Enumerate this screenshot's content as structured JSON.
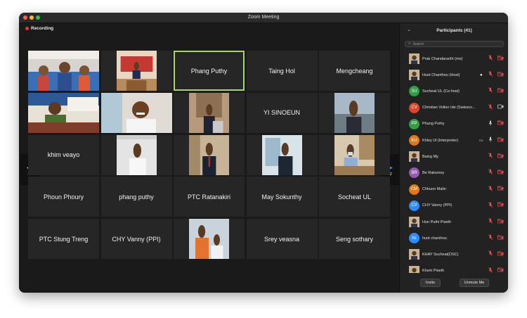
{
  "window": {
    "title": "Zoom Meeting"
  },
  "recording": {
    "label": "Recording"
  },
  "grid": {
    "page_indicator": "1/2",
    "tiles": [
      {
        "type": "video",
        "name": "",
        "scene": "group-outdoor"
      },
      {
        "type": "video",
        "name": "",
        "scene": "speaker-podium"
      },
      {
        "type": "name",
        "name": "Phang Puthy",
        "active": true
      },
      {
        "type": "name",
        "name": "Taing Hol"
      },
      {
        "type": "name",
        "name": "Mengcheang"
      },
      {
        "type": "video",
        "name": "",
        "scene": "speaker-banner"
      },
      {
        "type": "video",
        "name": "",
        "scene": "smiling-man"
      },
      {
        "type": "video",
        "name": "",
        "scene": "office-suit"
      },
      {
        "type": "name",
        "name": "YI SINOEUN"
      },
      {
        "type": "video",
        "name": "",
        "scene": "man-outdoor"
      },
      {
        "type": "name",
        "name": "khim veayo"
      },
      {
        "type": "video",
        "name": "",
        "scene": "man-white-shirt"
      },
      {
        "type": "video",
        "name": "",
        "scene": "man-suit-room"
      },
      {
        "type": "video",
        "name": "",
        "scene": "man-window"
      },
      {
        "type": "video",
        "name": "",
        "scene": "man-mask-desk"
      },
      {
        "type": "name",
        "name": "Phoun Phoury"
      },
      {
        "type": "name",
        "name": "phang puthy"
      },
      {
        "type": "name",
        "name": "PTC Ratanakiri"
      },
      {
        "type": "name",
        "name": "May Sokunthy"
      },
      {
        "type": "name",
        "name": "Socheat UL"
      },
      {
        "type": "name",
        "name": "PTC Stung Treng"
      },
      {
        "type": "name",
        "name": "CHY Vanny (PPI)"
      },
      {
        "type": "video",
        "name": "",
        "scene": "orange-shirts"
      },
      {
        "type": "name",
        "name": "Srey veasna"
      },
      {
        "type": "name",
        "name": "Seng sothary"
      }
    ]
  },
  "participants": {
    "header": "Participants (41)",
    "search_placeholder": "Search",
    "list": [
      {
        "name": "Prak Chandararith (me)",
        "initials": "",
        "avatar_color": "#8a6a50",
        "photo": true,
        "mic": "off",
        "video": "off"
      },
      {
        "name": "Huot Chanthou (Host)",
        "initials": "",
        "avatar_color": "#9a7b5e",
        "photo": true,
        "mic": "off",
        "video": "off",
        "speaking_dot": true
      },
      {
        "name": "Socheat UL (Co-host)",
        "initials": "SU",
        "avatar_color": "#2ea043",
        "mic": "off",
        "video": "off"
      },
      {
        "name": "Christian Volker Ide (Swissco...",
        "initials": "CV",
        "avatar_color": "#d9482b",
        "mic": "off",
        "video": "on"
      },
      {
        "name": "Phang Puthy",
        "initials": "PP",
        "avatar_color": "#2ea043",
        "mic": "on",
        "video": "off"
      },
      {
        "name": "Khley Ul (Interpreter)",
        "initials": "KU",
        "avatar_color": "#e0791a",
        "mic": "on",
        "video": "off",
        "badge": "EN"
      },
      {
        "name": "Baing My",
        "initials": "",
        "avatar_color": "#8a7060",
        "photo": true,
        "mic": "off",
        "video": "off"
      },
      {
        "name": "Be Raksmey",
        "initials": "BR",
        "avatar_color": "#9b59b6",
        "mic": "off",
        "video": "off"
      },
      {
        "name": "Chhuon Malin",
        "initials": "CM",
        "avatar_color": "#e0791a",
        "mic": "off",
        "video": "off"
      },
      {
        "name": "CHY Vanny (PPI)",
        "initials": "CV",
        "avatar_color": "#2d8cff",
        "mic": "off",
        "video": "off"
      },
      {
        "name": "Hun Puthi Piseth",
        "initials": "",
        "avatar_color": "#7a6050",
        "photo": true,
        "mic": "off",
        "video": "off"
      },
      {
        "name": "huot chanthou",
        "initials": "hc",
        "avatar_color": "#2d8cff",
        "mic": "off",
        "video": "off"
      },
      {
        "name": "KHAY Socheat(DSC)",
        "initials": "",
        "avatar_color": "#6a5a4e",
        "photo": true,
        "mic": "off",
        "video": "off"
      },
      {
        "name": "Khem Piseth",
        "initials": "",
        "avatar_color": "#8a6a55",
        "photo": true,
        "mic": "off",
        "video": "off"
      }
    ],
    "invite_label": "Invite",
    "unmute_label": "Unmute Me"
  }
}
